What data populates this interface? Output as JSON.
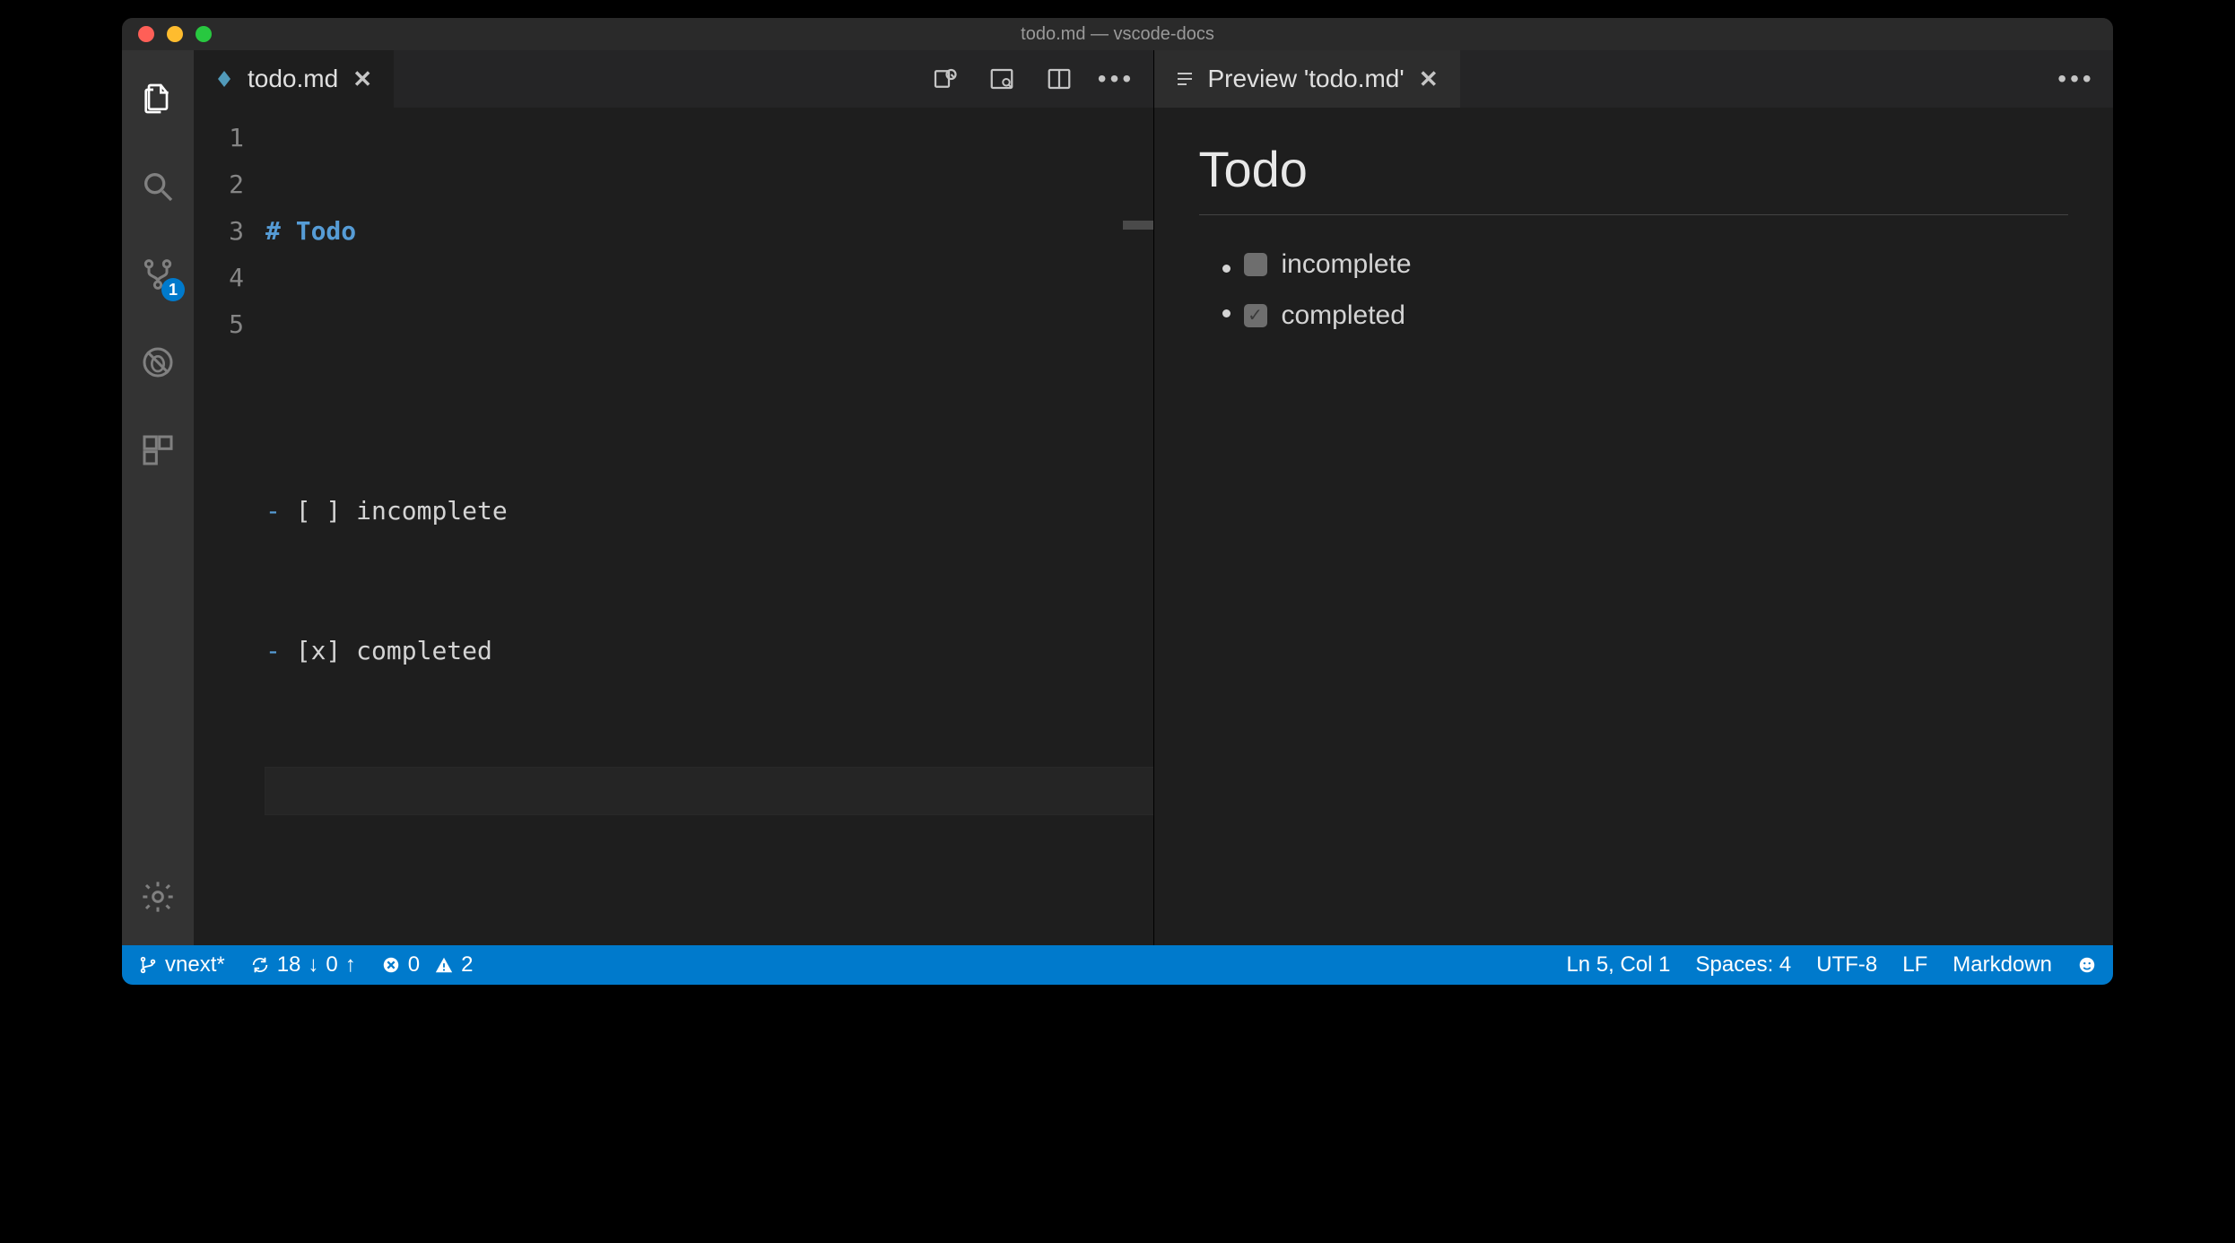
{
  "window": {
    "title": "todo.md — vscode-docs"
  },
  "activitybar": {
    "scm_badge": "1"
  },
  "editor_left": {
    "tab_label": "todo.md",
    "lines": {
      "l1_hash": "#",
      "l1_text": "Todo",
      "l3_dash": "-",
      "l3_box": "[ ]",
      "l3_text": "incomplete",
      "l4_dash": "-",
      "l4_box": "[x]",
      "l4_text": "completed"
    },
    "gutter": [
      "1",
      "2",
      "3",
      "4",
      "5"
    ]
  },
  "editor_right": {
    "tab_label": "Preview 'todo.md'",
    "heading": "Todo",
    "items": {
      "a": "incomplete",
      "b": "completed"
    }
  },
  "statusbar": {
    "branch": "vnext*",
    "sync_down": "18",
    "sync_up": "0",
    "errors": "0",
    "warnings": "2",
    "cursor": "Ln 5, Col 1",
    "spaces": "Spaces: 4",
    "encoding": "UTF-8",
    "eol": "LF",
    "language": "Markdown"
  }
}
